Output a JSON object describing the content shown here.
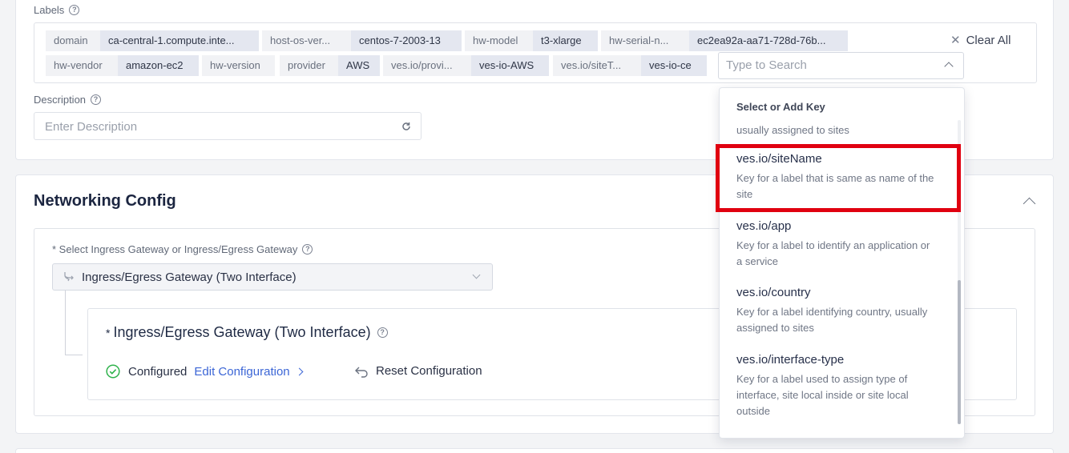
{
  "labels": {
    "title": "Labels",
    "chips": [
      {
        "key": "domain",
        "value": "ca-central-1.compute.inte..."
      },
      {
        "key": "host-os-ver...",
        "value": "centos-7-2003-13"
      },
      {
        "key": "hw-model",
        "value": "t3-xlarge"
      },
      {
        "key": "hw-serial-n...",
        "value": "ec2ea92a-aa71-728d-76b..."
      },
      {
        "key": "hw-vendor",
        "value": "amazon-ec2"
      },
      {
        "key": "hw-version",
        "value": ""
      },
      {
        "key": "provider",
        "value": "AWS"
      },
      {
        "key": "ves.io/provi...",
        "value": "ves-io-AWS"
      },
      {
        "key": "ves.io/siteT...",
        "value": "ves-io-ce"
      }
    ],
    "clear_all": "Clear All",
    "search_placeholder": "Type to Search"
  },
  "description": {
    "title": "Description",
    "placeholder": "Enter Description"
  },
  "networking": {
    "title": "Networking Config",
    "select_label": "* Select Ingress Gateway or Ingress/Egress Gateway",
    "select_value": "Ingress/Egress Gateway (Two Interface)",
    "panel_title": "Ingress/Egress Gateway (Two Interface)",
    "required_mark": "*",
    "status": "Configured",
    "edit_link": "Edit Configuration",
    "reset": "Reset Configuration"
  },
  "dropdown": {
    "header": "Select or Add Key",
    "partial_top_desc": "usually assigned to sites",
    "items": [
      {
        "key": "ves.io/siteName",
        "desc": "Key for a label that is same as name of the site"
      },
      {
        "key": "ves.io/app",
        "desc": "Key for a label to identify an application or a service"
      },
      {
        "key": "ves.io/country",
        "desc": "Key for a label identifying country, usually assigned to sites"
      },
      {
        "key": "ves.io/interface-type",
        "desc": "Key for a label used to assign type of interface, site local inside or site local outside"
      }
    ]
  },
  "colors": {
    "accent_link": "#3c66d6",
    "highlight": "#e00010",
    "success": "#2fb24c"
  }
}
